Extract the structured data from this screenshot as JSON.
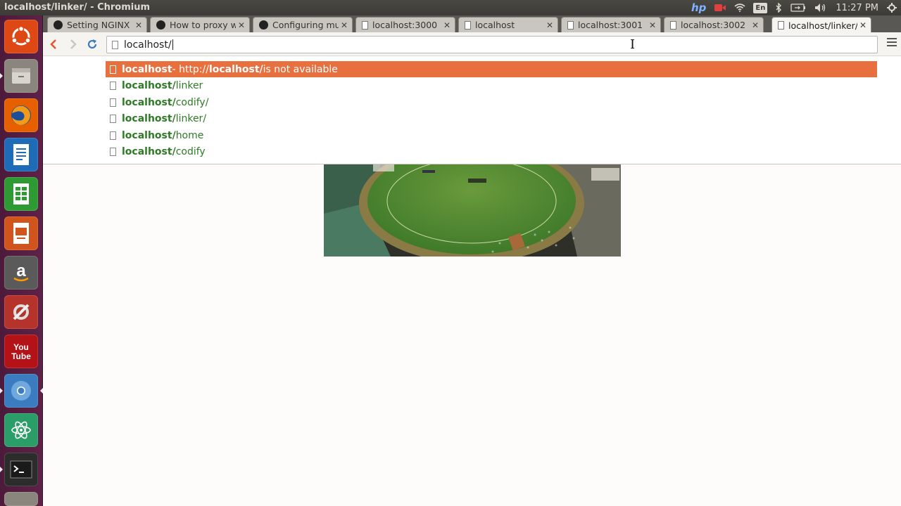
{
  "window": {
    "title": "localhost/linker/ - Chromium"
  },
  "system_tray": {
    "keyboard_layout": "En",
    "clock": "11:27 PM",
    "icons": [
      "hp-icon",
      "record-icon",
      "wifi-icon",
      "keyboard-icon",
      "bluetooth-icon",
      "battery-icon",
      "volume-icon",
      "settings-gear-icon"
    ]
  },
  "launcher": {
    "items": [
      {
        "name": "ubuntu-dash-icon",
        "color": "#dd4814"
      },
      {
        "name": "files-icon",
        "color": "#8a857d"
      },
      {
        "name": "firefox-icon",
        "color": "#e66000"
      },
      {
        "name": "writer-icon",
        "color": "#1e6bb8"
      },
      {
        "name": "calc-icon",
        "color": "#2e9a34"
      },
      {
        "name": "impress-icon",
        "color": "#d0541c"
      },
      {
        "name": "amazon-icon",
        "color": "#5a5a5a"
      },
      {
        "name": "system-settings-icon",
        "color": "#b5332a"
      },
      {
        "name": "youtube-icon",
        "color": "#b31217"
      },
      {
        "name": "chromium-icon",
        "color": "#3b7bbf"
      },
      {
        "name": "atom-icon",
        "color": "#2a9d69"
      },
      {
        "name": "terminal-icon",
        "color": "#2c2c2c"
      },
      {
        "name": "trash-icon",
        "color": "#8a857d"
      }
    ]
  },
  "tabs": [
    {
      "label": "Setting NGINX a",
      "icon": "github-icon"
    },
    {
      "label": "How to proxy w",
      "icon": "github-icon"
    },
    {
      "label": "Configuring mul",
      "icon": "github-icon"
    },
    {
      "label": "localhost:3000",
      "icon": "page-icon"
    },
    {
      "label": "localhost",
      "icon": "page-icon"
    },
    {
      "label": "localhost:3001",
      "icon": "page-icon"
    },
    {
      "label": "localhost:3002",
      "icon": "page-icon"
    },
    {
      "label": "localhost/linker/",
      "icon": "page-icon",
      "active": true
    }
  ],
  "toolbar": {
    "back_icon": "back-arrow-icon",
    "forward_icon": "forward-arrow-icon",
    "reload_icon": "reload-icon",
    "omnibox_value": "localhost/",
    "menu_icon": "hamburger-menu-icon"
  },
  "suggestions": [
    {
      "bold": "localhost",
      "rest": "",
      "desc_prefix": " - http://",
      "desc_bold": "localhost/",
      "desc_suffix": " is not available",
      "selected": true
    },
    {
      "bold": "localhost/",
      "rest": "linker"
    },
    {
      "bold": "localhost/",
      "rest": "codify/"
    },
    {
      "bold": "localhost/",
      "rest": "linker/"
    },
    {
      "bold": "localhost/",
      "rest": "home"
    },
    {
      "bold": "localhost/",
      "rest": "codify"
    }
  ],
  "page": {
    "image": "cricket-stadium-aerial-image"
  },
  "colors": {
    "accent_selected": "#e8703f",
    "suggestion_green": "#2f7a26",
    "launcher_bg": "#5e2247"
  }
}
